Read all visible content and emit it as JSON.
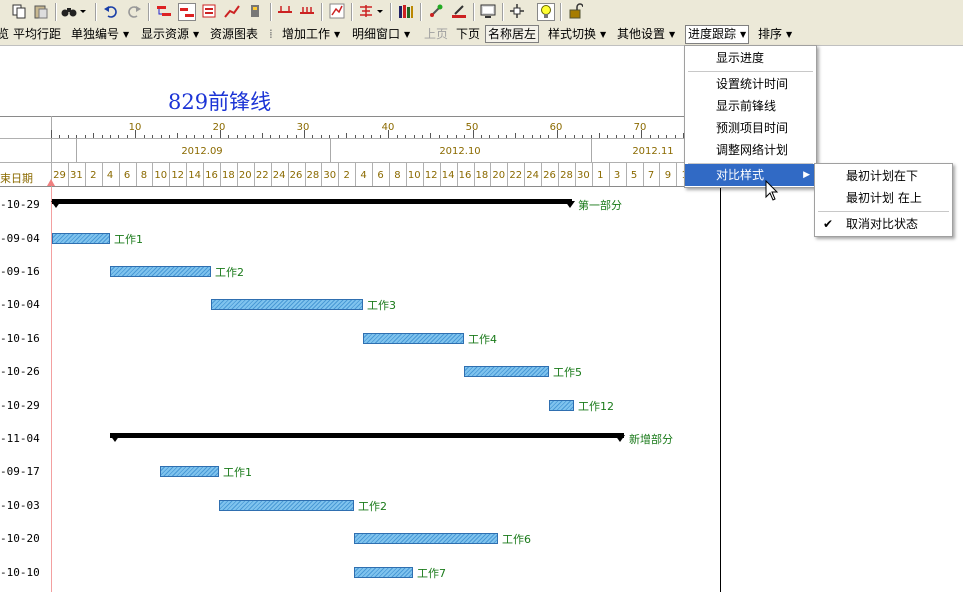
{
  "toolbar": {
    "icons": [
      "copy-icon",
      "paste-icon",
      "find-binoculars-icon",
      "undo-icon",
      "redo-icon",
      "link-task-icon",
      "unlink-task-icon",
      "task-list-icon",
      "trend-line-icon",
      "resource-icon",
      "split-icon",
      "merge-icon",
      "chart-icon",
      "align-icon",
      "books-icon",
      "tools-icon",
      "edit-icon",
      "monitor-icon",
      "network-icon",
      "lightbulb-icon",
      "unlock-icon"
    ]
  },
  "menubar": {
    "items": [
      {
        "label": "平均行距",
        "arrow": false
      },
      {
        "label": "单独编号",
        "arrow": true
      },
      {
        "label": "显示资源",
        "arrow": true
      },
      {
        "label": "资源图表",
        "arrow": false
      },
      {
        "label": "增加工作",
        "arrow": true
      },
      {
        "label": "明细窗口",
        "arrow": true
      },
      {
        "label": "上页",
        "arrow": false
      },
      {
        "label": "下页",
        "arrow": false
      },
      {
        "label": "名称居左",
        "arrow": false
      },
      {
        "label": "样式切换",
        "arrow": true
      },
      {
        "label": "其他设置",
        "arrow": true
      },
      {
        "label": "进度跟踪",
        "arrow": true
      },
      {
        "label": "排序",
        "arrow": true
      }
    ],
    "partial_left": "览"
  },
  "chart": {
    "title": "829前锋线",
    "date_column_header": "束日期",
    "scale_numbers": [
      "10",
      "20",
      "30",
      "40",
      "50",
      "60",
      "70"
    ],
    "months": [
      "2012.09",
      "2012.10",
      "2012.11"
    ],
    "days": [
      "29",
      "31",
      "2",
      "4",
      "6",
      "8",
      "10",
      "12",
      "14",
      "16",
      "18",
      "20",
      "22",
      "24",
      "26",
      "28",
      "30",
      "2",
      "4",
      "6",
      "8",
      "10",
      "12",
      "14",
      "16",
      "18",
      "20",
      "22",
      "24",
      "26",
      "28",
      "30",
      "1",
      "3",
      "5",
      "7",
      "9",
      "1"
    ],
    "rows": [
      {
        "date": "-10-29",
        "label": "第一部分",
        "summary": true
      },
      {
        "date": "-09-04",
        "label": "工作1",
        "summary": false
      },
      {
        "date": "-09-16",
        "label": "工作2",
        "summary": false
      },
      {
        "date": "-10-04",
        "label": "工作3",
        "summary": false
      },
      {
        "date": "-10-16",
        "label": "工作4",
        "summary": false
      },
      {
        "date": "-10-26",
        "label": "工作5",
        "summary": false
      },
      {
        "date": "-10-29",
        "label": "工作12",
        "summary": false
      },
      {
        "date": "-11-04",
        "label": "新增部分",
        "summary": true
      },
      {
        "date": "-09-17",
        "label": "工作1",
        "summary": false
      },
      {
        "date": "-10-03",
        "label": "工作2",
        "summary": false
      },
      {
        "date": "-10-20",
        "label": "工作6",
        "summary": false
      },
      {
        "date": "-10-10",
        "label": "工作7",
        "summary": false
      }
    ]
  },
  "progress_menu": {
    "items": [
      "显示进度",
      "设置统计时间",
      "显示前锋线",
      "预测项目时间",
      "调整网络计划",
      "对比样式"
    ]
  },
  "compare_submenu": {
    "items": [
      "最初计划在下",
      "最初计划 在上",
      "取消对比状态"
    ],
    "checked_index": 2
  }
}
